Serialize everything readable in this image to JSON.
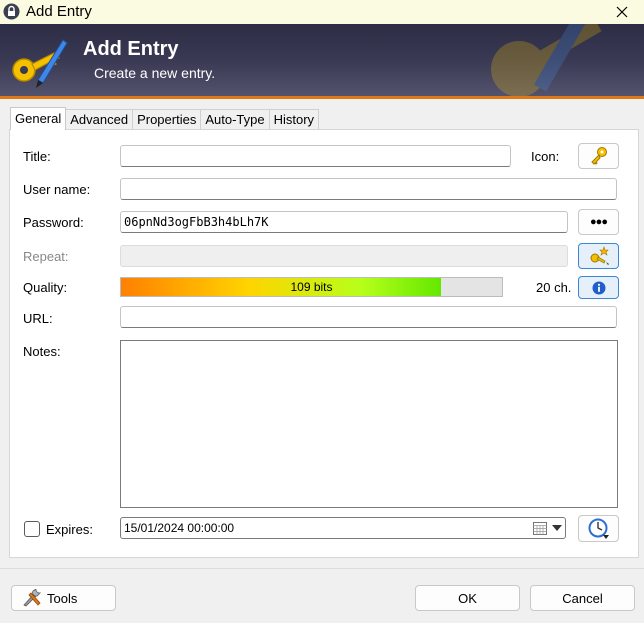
{
  "window": {
    "title": "Add Entry"
  },
  "banner": {
    "heading": "Add Entry",
    "subheading": "Create a new entry."
  },
  "tabs": [
    {
      "label": "General",
      "active": true
    },
    {
      "label": "Advanced",
      "active": false
    },
    {
      "label": "Properties",
      "active": false
    },
    {
      "label": "Auto-Type",
      "active": false
    },
    {
      "label": "History",
      "active": false
    }
  ],
  "form": {
    "title_label": "Title:",
    "title_value": "",
    "icon_label": "Icon:",
    "username_label": "User name:",
    "username_value": "",
    "password_label": "Password:",
    "password_value": "06pnNd3ogFbB3h4bLh7K",
    "show_password_label": "●●●",
    "repeat_label": "Repeat:",
    "repeat_value": "",
    "quality_label": "Quality:",
    "quality_text": "109 bits",
    "quality_fraction": 0.84,
    "quality_chars": "20 ch.",
    "url_label": "URL:",
    "url_value": "",
    "notes_label": "Notes:",
    "notes_value": "",
    "expires_label": "Expires:",
    "expires_value": "15/01/2024 00:00:00",
    "expires_checked": false
  },
  "footer": {
    "tools_label": "Tools",
    "ok_label": "OK",
    "cancel_label": "Cancel"
  },
  "colors": {
    "accent": "#3a86d9",
    "banner_line": "#e07818",
    "key_yellow": "#f5c000"
  }
}
